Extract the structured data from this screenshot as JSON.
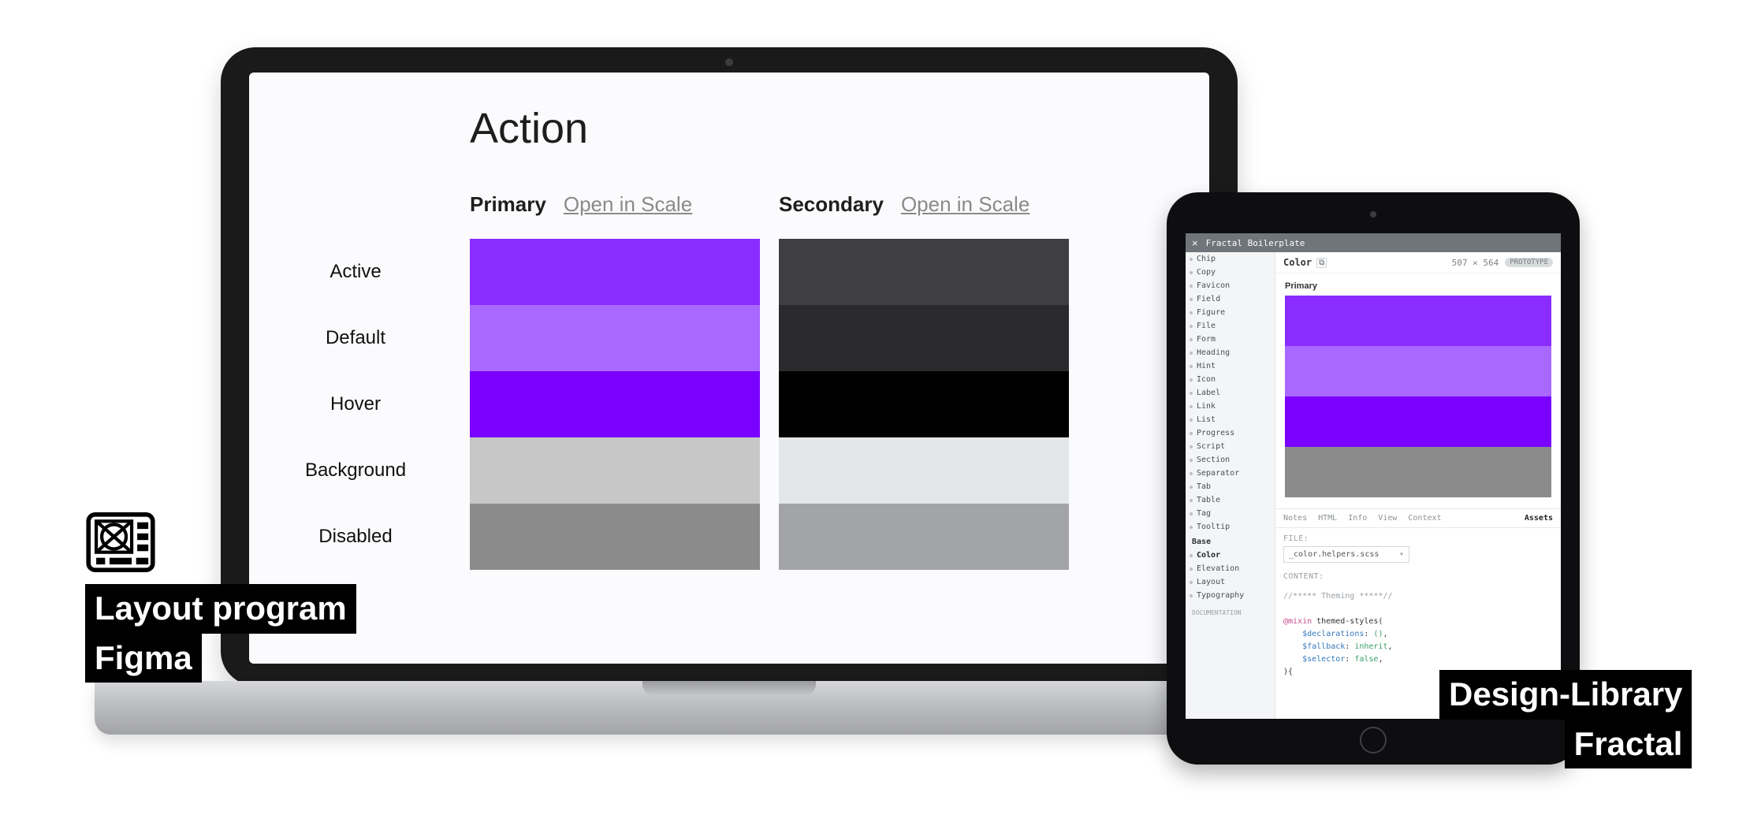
{
  "figma": {
    "title": "Action",
    "columns": [
      {
        "title": "Primary",
        "open_label": "Open in Scale"
      },
      {
        "title": "Secondary",
        "open_label": "Open in Scale"
      }
    ],
    "rows": [
      {
        "label": "Active",
        "primary": "#8A2BFF",
        "secondary": "#3F3F41"
      },
      {
        "label": "Default",
        "primary": "#A968FF",
        "secondary": "#2A2A2C"
      },
      {
        "label": "Hover",
        "primary": "#7A00FF",
        "secondary": "#000000"
      },
      {
        "label": "Background",
        "primary": "#C7C7C7",
        "secondary": "#E4E7E8"
      },
      {
        "label": "Disabled",
        "primary": "#8B8B8B",
        "secondary": "#A2A4A5"
      }
    ]
  },
  "fractal": {
    "titlebar": {
      "close_glyph": "×",
      "title": "Fractal Boilerplate"
    },
    "sidebar": {
      "items": [
        "Chip",
        "Copy",
        "Favicon",
        "Field",
        "Figure",
        "File",
        "Form",
        "Heading",
        "Hint",
        "Icon",
        "Label",
        "Link",
        "List",
        "Progress",
        "Script",
        "Section",
        "Separator",
        "Tab",
        "Table",
        "Tag",
        "Tooltip"
      ],
      "section_label": "Base",
      "base_items": [
        "Color",
        "Elevation",
        "Layout",
        "Typography"
      ],
      "active_item": "Color",
      "footer_item": "DOCUMENTATION"
    },
    "header": {
      "title": "Color",
      "copy_glyph": "⧉",
      "dims": "507 × 564",
      "badge": "PROTOTYPE"
    },
    "preview": {
      "title": "Primary",
      "stripes": [
        "#8A2BFF",
        "#A968FF",
        "#7A00FF",
        "#8B8B8B"
      ]
    },
    "tabs": [
      "Notes",
      "HTML",
      "Info",
      "View",
      "Context",
      "Assets"
    ],
    "active_tab": "Assets",
    "panel": {
      "file_label": "FILE:",
      "file_value": "_color.helpers.scss",
      "content_label": "CONTENT:",
      "code": {
        "comment": "//***** Theming *****//",
        "mixin": "@mixin",
        "name": "themed-styles(",
        "p1": "$declarations",
        "v1": "()",
        "p2": "$fallback",
        "v2": "inherit",
        "p3": "$selector",
        "v3": "false",
        "close": "){"
      }
    }
  },
  "captions": {
    "left": {
      "line1": "Layout program",
      "line2": "Figma"
    },
    "right": {
      "line1": "Design-Library",
      "line2": "Fractal"
    }
  }
}
